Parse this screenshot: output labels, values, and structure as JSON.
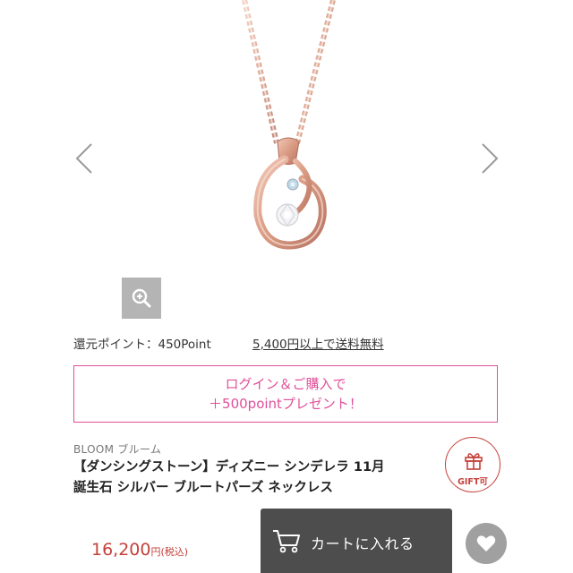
{
  "gallery": {
    "prev_icon": "chevron-left-icon",
    "next_icon": "chevron-right-icon",
    "zoom_icon": "zoom-in-icon"
  },
  "info": {
    "points_label": "還元ポイント：450Point",
    "shipping_label": "5,400円以上で送料無料"
  },
  "promo": {
    "line1": "ログイン＆ご購入で",
    "line2": "＋500pointプレゼント！",
    "color": "#e0509a"
  },
  "product": {
    "brand": "BLOOM ブルーム",
    "title_line1": "【ダンシングストーン】ディズニー シンデレラ 11月",
    "title_line2": "誕生石 シルバー ブルートパーズ ネックレス",
    "gift_label": "GIFT可",
    "gift_icon": "gift-icon"
  },
  "purchase": {
    "price": "16,200",
    "price_suffix": "円(税込)",
    "cart_label": "カートに入れる",
    "cart_icon": "cart-icon",
    "favorite_icon": "heart-icon",
    "price_color": "#c4413a",
    "button_color": "#4d4d4d"
  }
}
